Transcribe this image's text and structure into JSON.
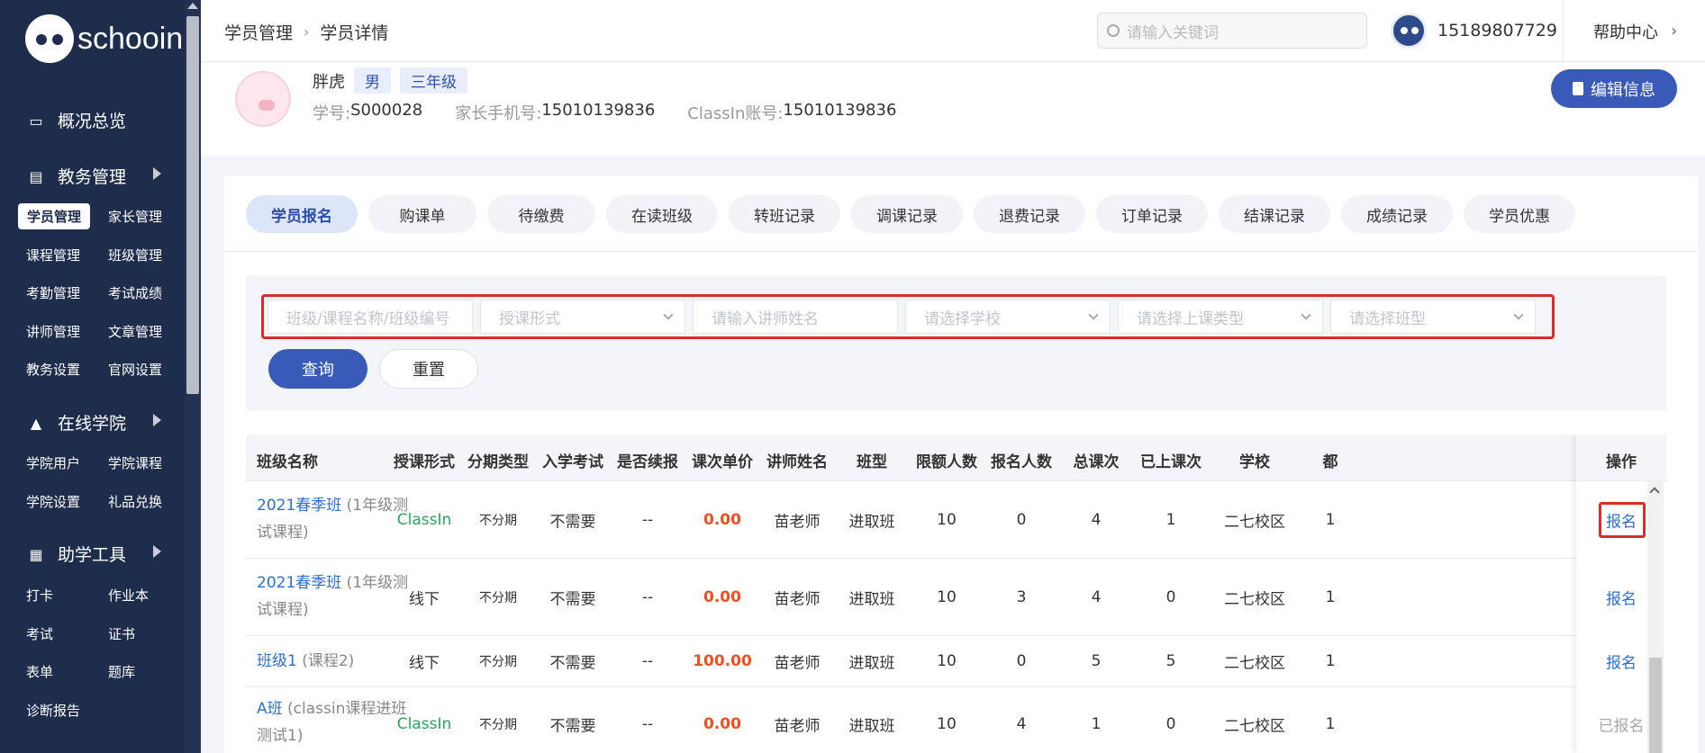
{
  "sidebar": {
    "logo": "schooin",
    "groups": [
      {
        "label": "概况总览",
        "icon": "monitor-icon"
      },
      {
        "label": "教务管理",
        "icon": "book-icon"
      },
      {
        "label": "在线学院",
        "icon": "graduation-cap-icon"
      },
      {
        "label": "助学工具",
        "icon": "grid-icon"
      }
    ],
    "jiaowu_items": [
      "学员管理",
      "家长管理",
      "课程管理",
      "班级管理",
      "考勤管理",
      "考试成绩",
      "讲师管理",
      "文章管理",
      "教务设置",
      "官网设置"
    ],
    "online_items": [
      "学院用户",
      "学院课程",
      "学院设置",
      "礼品兑换"
    ],
    "tool_items": [
      "打卡",
      "作业本",
      "考试",
      "证书",
      "表单",
      "题库",
      "诊断报告"
    ],
    "active": "学员管理"
  },
  "header": {
    "breadcrumb": [
      "学员管理",
      "学员详情"
    ],
    "search_placeholder": "请输入关键词",
    "phone": "15189807729",
    "help": "帮助中心"
  },
  "profile": {
    "name": "胖虎",
    "gender": "男",
    "grade": "三年级",
    "student_no_label": "学号:",
    "student_no": "S000028",
    "parent_phone_label": "家长手机号:",
    "parent_phone": "15010139836",
    "classin_label": "ClassIn账号:",
    "classin": "15010139836",
    "edit_label": "编辑信息"
  },
  "tabs": [
    "学员报名",
    "购课单",
    "待缴费",
    "在读班级",
    "转班记录",
    "调课记录",
    "退费记录",
    "订单记录",
    "结课记录",
    "成绩记录",
    "学员优惠"
  ],
  "filters": {
    "placeholders": [
      "班级/课程名称/班级编号",
      "授课形式",
      "请输入讲师姓名",
      "请选择学校",
      "请选择上课类型",
      "请选择班型"
    ],
    "query": "查询",
    "reset": "重置"
  },
  "table": {
    "headers": [
      "班级名称",
      "授课形式",
      "分期类型",
      "入学考试",
      "是否续报",
      "课次单价",
      "讲师姓名",
      "班型",
      "限额人数",
      "报名人数",
      "总课次",
      "已上课次",
      "学校",
      "都",
      "操作"
    ],
    "rows": [
      {
        "class": "2021春季班",
        "course": "(1年级测试课程)",
        "mode": "ClassIn",
        "installment": "不分期",
        "exam": "不需要",
        "renew": "--",
        "price": "0.00",
        "teacher": "苗老师",
        "type": "进取班",
        "limit": "10",
        "enrolled": "0",
        "total": "4",
        "done": "1",
        "school": "二七校区",
        "extra": "1",
        "action": "报名"
      },
      {
        "class": "2021春季班",
        "course": "(1年级测试课程)",
        "mode": "线下",
        "installment": "不分期",
        "exam": "不需要",
        "renew": "--",
        "price": "0.00",
        "teacher": "苗老师",
        "type": "进取班",
        "limit": "10",
        "enrolled": "3",
        "total": "4",
        "done": "0",
        "school": "二七校区",
        "extra": "1",
        "action": "报名"
      },
      {
        "class": "班级1",
        "course": "(课程2)",
        "mode": "线下",
        "installment": "不分期",
        "exam": "不需要",
        "renew": "--",
        "price": "100.00",
        "teacher": "苗老师",
        "type": "进取班",
        "limit": "10",
        "enrolled": "0",
        "total": "5",
        "done": "5",
        "school": "二七校区",
        "extra": "1",
        "action": "报名"
      },
      {
        "class": "A班",
        "course": "(classin课程进班测试1)",
        "mode": "ClassIn",
        "installment": "不分期",
        "exam": "不需要",
        "renew": "--",
        "price": "0.00",
        "teacher": "苗老师",
        "type": "进取班",
        "limit": "10",
        "enrolled": "4",
        "total": "1",
        "done": "0",
        "school": "二七校区",
        "extra": "1",
        "action": "已报名"
      }
    ]
  },
  "colors": {
    "sidebar": "#1f2d4d",
    "primary": "#3a5ab8",
    "highlight": "#e02a2a",
    "price": "#f04e23",
    "classin": "#2aa55e"
  }
}
